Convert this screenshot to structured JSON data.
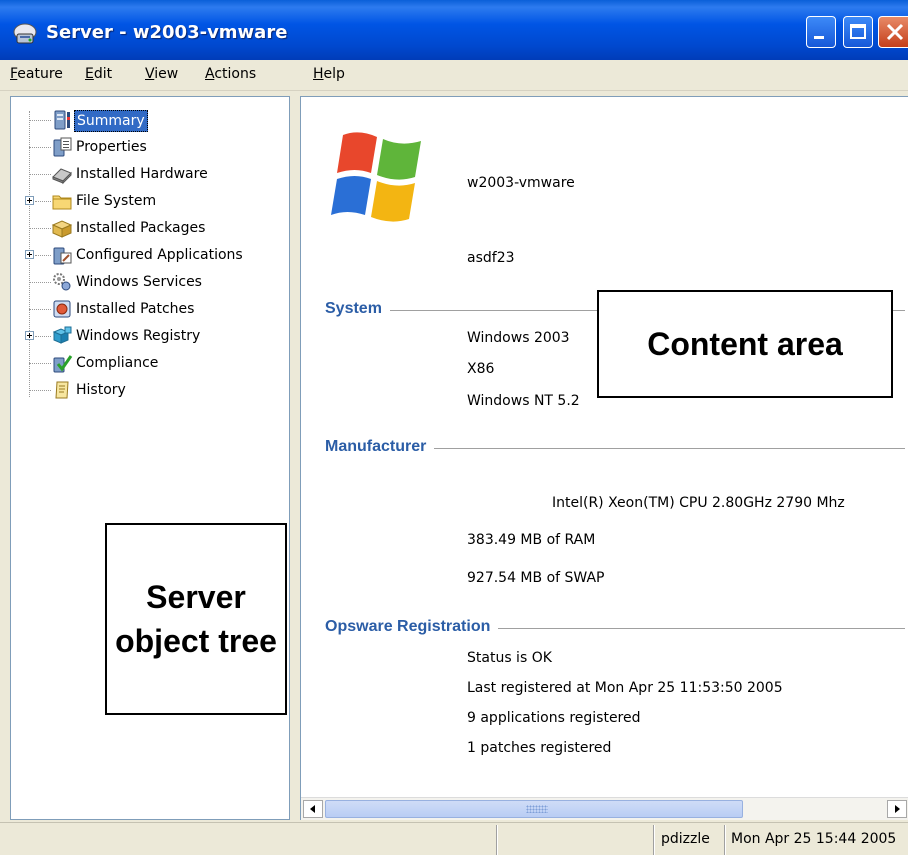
{
  "window": {
    "title": "Server - w2003-vmware",
    "controls": {
      "minimize": "minimize-icon",
      "maximize": "maximize-icon",
      "close": "close-icon"
    }
  },
  "menu": [
    "Feature",
    "Edit",
    "View",
    "Actions",
    "Help"
  ],
  "tree": {
    "items": [
      {
        "label": "Summary",
        "icon": "server-summary-icon",
        "selected": true,
        "expandable": false
      },
      {
        "label": "Properties",
        "icon": "properties-icon",
        "selected": false,
        "expandable": false
      },
      {
        "label": "Installed Hardware",
        "icon": "hardware-icon",
        "selected": false,
        "expandable": false
      },
      {
        "label": "File System",
        "icon": "folder-icon",
        "selected": false,
        "expandable": true
      },
      {
        "label": "Installed Packages",
        "icon": "package-icon",
        "selected": false,
        "expandable": false
      },
      {
        "label": "Configured Applications",
        "icon": "applications-icon",
        "selected": false,
        "expandable": true
      },
      {
        "label": "Windows Services",
        "icon": "services-icon",
        "selected": false,
        "expandable": false
      },
      {
        "label": "Installed Patches",
        "icon": "patch-icon",
        "selected": false,
        "expandable": false
      },
      {
        "label": "Windows Registry",
        "icon": "registry-icon",
        "selected": false,
        "expandable": true
      },
      {
        "label": "Compliance",
        "icon": "compliance-icon",
        "selected": false,
        "expandable": false
      },
      {
        "label": "History",
        "icon": "history-icon",
        "selected": false,
        "expandable": false
      }
    ]
  },
  "callouts": {
    "tree": "Server object tree",
    "content": "Content area"
  },
  "content": {
    "logo": "windows-logo-icon",
    "hostname": "w2003-vmware",
    "description": "asdf23",
    "system": {
      "heading": "System",
      "values": [
        "Windows 2003",
        "X86",
        "Windows NT 5.2"
      ]
    },
    "manufacturer": {
      "heading": "Manufacturer",
      "cpu": "Intel(R) Xeon(TM) CPU 2.80GHz 2790 Mhz",
      "ram": "383.49 MB of RAM",
      "swap": "927.54 MB of SWAP"
    },
    "opsware": {
      "heading": "Opsware Registration",
      "values": [
        "Status is OK",
        "Last registered at Mon Apr 25 11:53:50 2005",
        "9 applications registered",
        "1 patches registered"
      ]
    }
  },
  "status": {
    "user": "pdizzle",
    "datetime": "Mon Apr 25 15:44 2005"
  }
}
